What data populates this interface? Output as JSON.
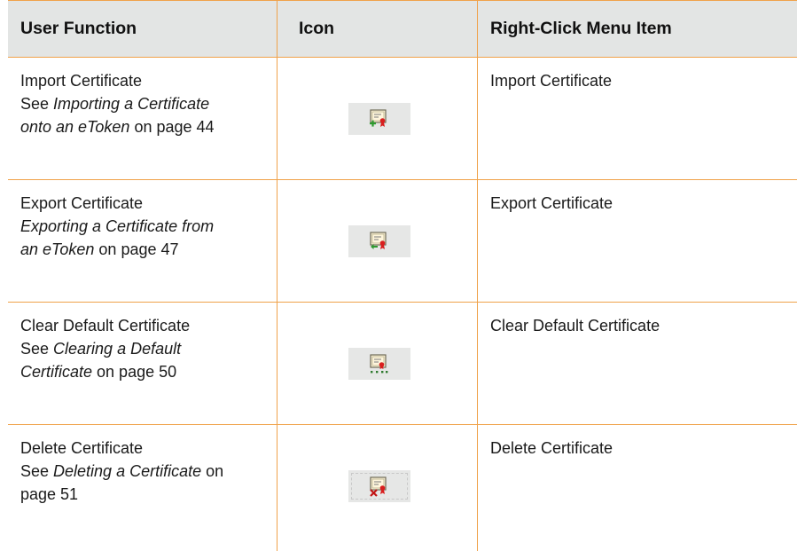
{
  "header": {
    "col1": "User Function",
    "col2": "Icon",
    "col3": "Right-Click Menu Item"
  },
  "rows": [
    {
      "function_title": "Import Certificate",
      "ref_prefix": "See ",
      "ref_italic": "Importing a Certificate onto an eToken",
      "ref_suffix": " on page 44",
      "icon": "import-certificate-icon",
      "menu_item": "Import Certificate"
    },
    {
      "function_title": "Export Certificate",
      "ref_prefix": "",
      "ref_italic": "Exporting a Certificate from an eToken",
      "ref_suffix": " on page 47",
      "icon": "export-certificate-icon",
      "menu_item": "Export Certificate"
    },
    {
      "function_title": "Clear Default Certificate",
      "ref_prefix": "See ",
      "ref_italic": "Clearing a Default Certificate",
      "ref_suffix": " on page 50",
      "icon": "clear-default-certificate-icon",
      "menu_item": "Clear Default Certificate"
    },
    {
      "function_title": "Delete Certificate",
      "ref_prefix": "See ",
      "ref_italic": "Deleting a Certificate",
      "ref_suffix": " on page 51",
      "icon": "delete-certificate-icon",
      "menu_item": "Delete Certificate"
    }
  ],
  "colors": {
    "rule": "#f0a24a",
    "header_bg": "#e3e5e4",
    "icon_bg": "#e6e7e6"
  }
}
